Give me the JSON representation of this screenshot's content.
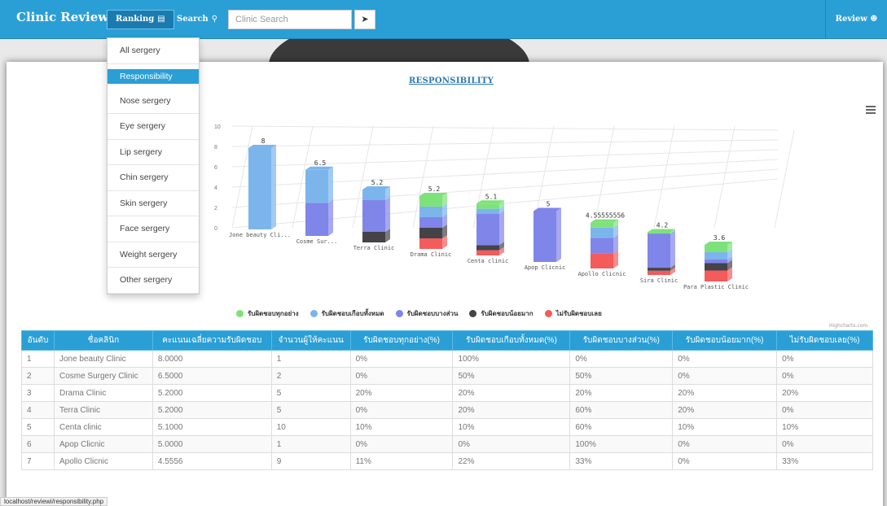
{
  "navbar": {
    "brand": "Clinic Review",
    "ranking_label": "Ranking",
    "ranking_icon": "list-icon",
    "search_label": "Search",
    "search_icon": "search-icon",
    "search_placeholder": "Clinic Search",
    "send_icon": "send-icon",
    "review_label": "Review",
    "review_icon": "user-icon"
  },
  "dropdown": {
    "items": [
      "All sergery",
      "Responsibility",
      "Nose sergery",
      "Eye sergery",
      "Lip sergery",
      "Chin sergery",
      "Skin sergery",
      "Face sergery",
      "Weight sergery",
      "Other sergery"
    ],
    "active_index": 1
  },
  "card": {
    "title": "RESPONSIBILITY",
    "credits": "Highcharts.com"
  },
  "colors": {
    "primary": "#2a9fd6",
    "green": "#7ee27b",
    "blue": "#7cb5ec",
    "purple": "#8085e9",
    "dark": "#434348",
    "red": "#f45b5b"
  },
  "chart_data": {
    "type": "bar",
    "categories": [
      "Jone beauty Cli...",
      "Cosme Sur...",
      "Terra Clinic",
      "Drama Clinic",
      "Centa clinic",
      "Apop Clicnic",
      "Apollo Clicnic",
      "Sira Clinic",
      "Para Plastic Clinic"
    ],
    "totals": [
      8,
      6.5,
      5.2,
      5.2,
      5.1,
      5,
      4.55555556,
      4.2,
      3.6
    ],
    "total_labels": [
      "8",
      "6.5",
      "5.2",
      "5.2",
      "5.1",
      "5",
      "4.55555556",
      "4.2",
      "3.6"
    ],
    "series": [
      {
        "name": "ไม่รับผิดชอบเลย",
        "color": "#f45b5b",
        "values": [
          0,
          0,
          0,
          20,
          10,
          0,
          33,
          10,
          30
        ]
      },
      {
        "name": "รับผิดชอบน้อยมาก",
        "color": "#434348",
        "values": [
          0,
          0,
          20,
          20,
          10,
          0,
          0,
          7,
          20
        ]
      },
      {
        "name": "รับผิดชอบบางส่วน",
        "color": "#8085e9",
        "values": [
          0,
          50,
          60,
          20,
          60,
          100,
          33,
          80,
          10
        ]
      },
      {
        "name": "รับผิดชอบเกือบทั้งหมด",
        "color": "#7cb5ec",
        "values": [
          100,
          50,
          20,
          20,
          10,
          0,
          22,
          0,
          20
        ]
      },
      {
        "name": "รับผิดชอบทุกอย่าง",
        "color": "#7ee27b",
        "values": [
          0,
          0,
          0,
          20,
          10,
          0,
          11,
          3,
          20
        ]
      }
    ],
    "legend_order": [
      "รับผิดชอบทุกอย่าง",
      "รับผิดชอบเกือบทั้งหมด",
      "รับผิดชอบบางส่วน",
      "รับผิดชอบน้อยมาก",
      "ไม่รับผิดชอบเลย"
    ],
    "ylim": [
      0,
      10
    ],
    "yticks": [
      "0",
      "2",
      "4",
      "6",
      "8",
      "10"
    ],
    "ylabel": "คะแนนเฉลี่ยความรับผิดชอบ",
    "legend_position": "bottom"
  },
  "table": {
    "headers": [
      "อันดับ",
      "ชื่อคลินิก",
      "คะแนนเฉลี่ยความรับผิดชอบ",
      "จำนวนผู้ให้คะแนน",
      "รับผิดชอบทุกอย่าง(%)",
      "รับผิดชอบเกือบทั้งหมด(%)",
      "รับผิดชอบบางส่วน(%)",
      "รับผิดชอบน้อยมาก(%)",
      "ไม่รับผิดชอบเลย(%)"
    ],
    "rows": [
      [
        "1",
        "Jone beauty Clinic",
        "8.0000",
        "1",
        "0%",
        "100%",
        "0%",
        "0%",
        "0%"
      ],
      [
        "2",
        "Cosme Surgery Clinic",
        "6.5000",
        "2",
        "0%",
        "50%",
        "50%",
        "0%",
        "0%"
      ],
      [
        "3",
        "Drama Clinic",
        "5.2000",
        "5",
        "20%",
        "20%",
        "20%",
        "20%",
        "20%"
      ],
      [
        "4",
        "Terra Clinic",
        "5.2000",
        "5",
        "0%",
        "20%",
        "60%",
        "20%",
        "0%"
      ],
      [
        "5",
        "Centa clinic",
        "5.1000",
        "10",
        "10%",
        "10%",
        "60%",
        "10%",
        "10%"
      ],
      [
        "6",
        "Apop Clicnic",
        "5.0000",
        "1",
        "0%",
        "0%",
        "100%",
        "0%",
        "0%"
      ],
      [
        "7",
        "Apollo Clicnic",
        "4.5556",
        "9",
        "11%",
        "22%",
        "33%",
        "0%",
        "33%"
      ]
    ]
  },
  "status_url": "localhost/reviewi/responsibility.php"
}
